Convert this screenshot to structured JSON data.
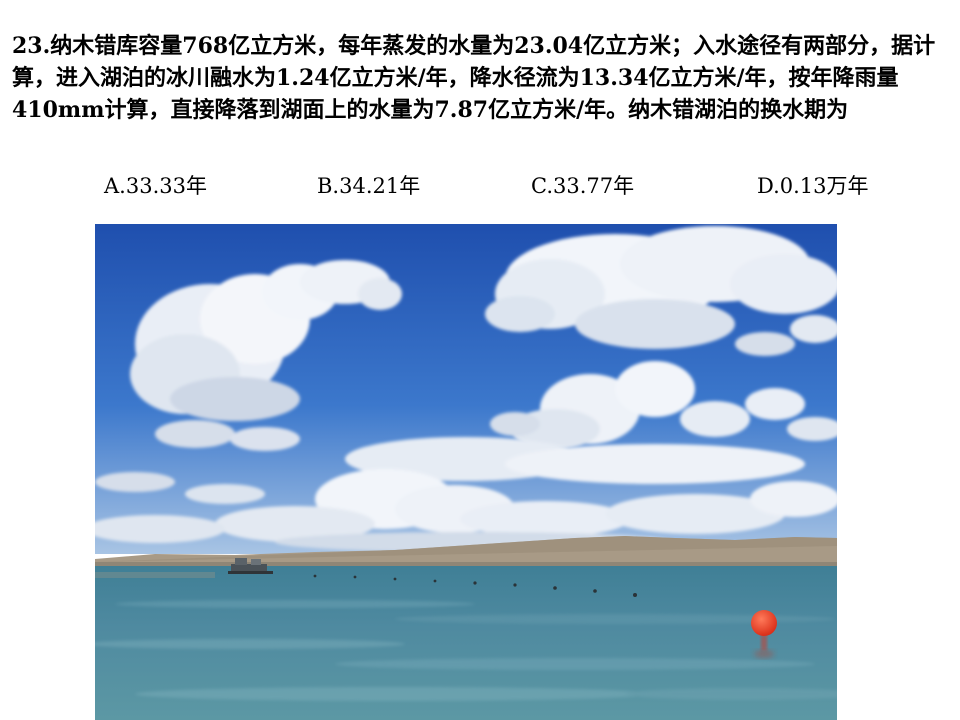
{
  "question": {
    "text": "23.纳木错库容量768亿立方米，每年蒸发的水量为23.04亿立方米；入水途径有两部分，据计算，进入湖泊的冰川融水为1.24亿立方米/年，降水径流为13.34亿立方米/年，按年降雨量410mm计算，直接降落到湖面上的水量为7.87亿立方米/年。纳木错湖泊的换水期为"
  },
  "options": [
    {
      "label": "A.33.33年"
    },
    {
      "label": "B.34.21年"
    },
    {
      "label": "C.33.77年"
    },
    {
      "label": "D.0.13万年"
    }
  ],
  "photo": {
    "colors": {
      "sky_top": "#1f4fae",
      "sky_mid": "#3c78cc",
      "sky_horizon": "#a8c4e4",
      "mountains": "#a89a86",
      "lake_far": "#3f7f96",
      "lake_near": "#5c98a4",
      "buoy": "#e8321e"
    }
  }
}
